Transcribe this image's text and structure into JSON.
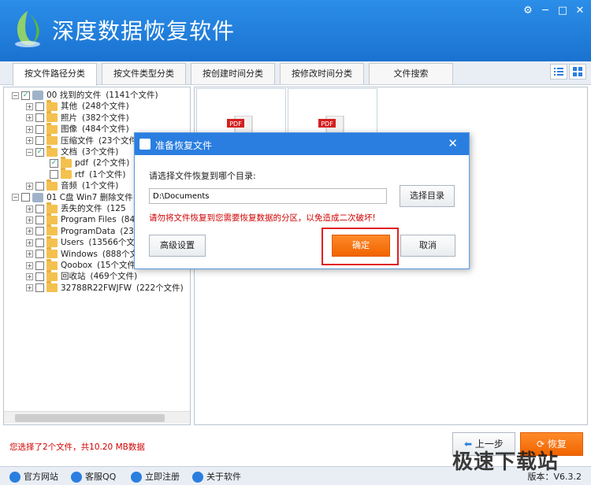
{
  "app": {
    "title": "深度数据恢复软件"
  },
  "window_controls": {
    "settings": "⚙",
    "minimize": "─",
    "maximize": "□",
    "close": "✕"
  },
  "tabs": [
    {
      "label": "按文件路径分类"
    },
    {
      "label": "按文件类型分类"
    },
    {
      "label": "按创建时间分类"
    },
    {
      "label": "按修改时间分类"
    },
    {
      "label": "文件搜索"
    }
  ],
  "tree": [
    {
      "label": "00 找到的文件",
      "count": "(1141个文件)",
      "checked": true,
      "expand": "−"
    },
    {
      "label": "其他",
      "count": "(248个文件)",
      "checked": false,
      "expand": "+"
    },
    {
      "label": "照片",
      "count": "(382个文件)",
      "checked": false,
      "expand": "+"
    },
    {
      "label": "图像",
      "count": "(484个文件)",
      "checked": false,
      "expand": "+"
    },
    {
      "label": "压缩文件",
      "count": "(23个文件)",
      "checked": false,
      "expand": "+"
    },
    {
      "label": "文档",
      "count": "(3个文件)",
      "checked": true,
      "expand": "−"
    },
    {
      "label": "pdf",
      "count": "(2个文件)",
      "checked": true,
      "expand": ""
    },
    {
      "label": "rtf",
      "count": "(1个文件)",
      "checked": false,
      "expand": ""
    },
    {
      "label": "音频",
      "count": "(1个文件)",
      "checked": false,
      "expand": "+"
    },
    {
      "label": "01 C盘 Win7 删除文件 (",
      "count": "",
      "checked": false,
      "expand": "−"
    },
    {
      "label": "丢失的文件",
      "count": "(125",
      "checked": false,
      "expand": "+"
    },
    {
      "label": "Program Files",
      "count": "(842",
      "checked": false,
      "expand": "+"
    },
    {
      "label": "ProgramData",
      "count": "(237",
      "checked": false,
      "expand": "+"
    },
    {
      "label": "Users",
      "count": "(13566个文",
      "checked": false,
      "expand": "+"
    },
    {
      "label": "Windows",
      "count": "(888个文",
      "checked": false,
      "expand": "+"
    },
    {
      "label": "Qoobox",
      "count": "(15个文件)",
      "checked": false,
      "expand": "+"
    },
    {
      "label": "回收站",
      "count": "(469个文件)",
      "checked": false,
      "expand": "+"
    },
    {
      "label": "32788R22FWJFW",
      "count": "(222个文件)",
      "checked": false,
      "expand": "+"
    }
  ],
  "files": [
    {
      "type": "PDF"
    },
    {
      "type": "PDF"
    }
  ],
  "dialog": {
    "title": "准备恢复文件",
    "prompt": "请选择文件恢复到哪个目录:",
    "path_value": "D:\\Documents",
    "choose_dir": "选择目录",
    "warning": "请勿将文件恢复到您需要恢复数据的分区，以免造成二次破坏!",
    "advanced": "高级设置",
    "confirm": "确定",
    "cancel": "取消"
  },
  "status": "您选择了2个文件，共10.20 MB数据",
  "nav": {
    "prev": "上一步",
    "recover": "恢复"
  },
  "footer": {
    "website": "官方网站",
    "qq": "客服QQ",
    "register": "立即注册",
    "about": "关于软件",
    "version": "版本：V6.3.2"
  },
  "watermark": "极速下载站",
  "colors": {
    "accent": "#2a7ee0",
    "orange": "#f06400",
    "warning": "#d10000"
  }
}
